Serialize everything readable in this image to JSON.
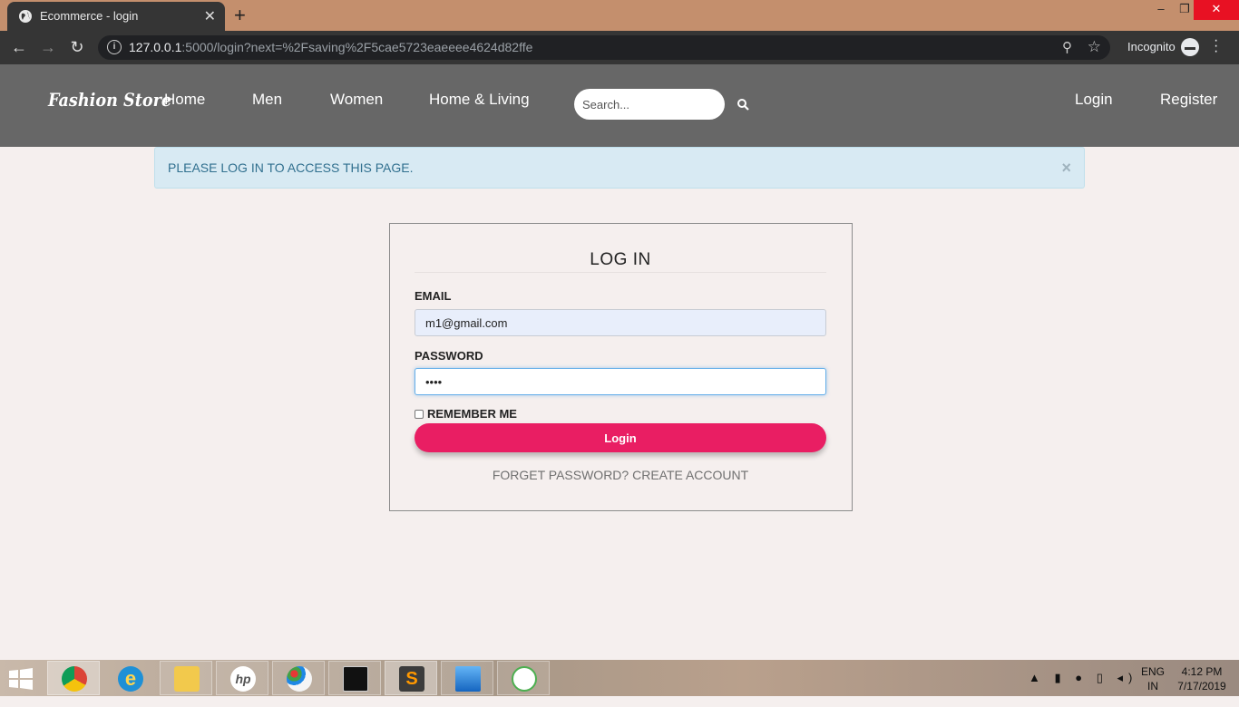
{
  "browser": {
    "tab_title": "Ecommerce - login",
    "tab_close": "✕",
    "new_tab": "+",
    "url_host": "127.0.0.1",
    "url_rest": ":5000/login?next=%2Fsaving%2F5cae5723eaeeee4624d82ffe",
    "incognito_label": "Incognito",
    "window_controls": {
      "minimize": "–",
      "maximize": "❐",
      "close": "✕"
    }
  },
  "navbar": {
    "brand": "Fashion Store",
    "links": [
      "Home",
      "Men",
      "Women",
      "Home & Living"
    ],
    "search_placeholder": "Search...",
    "login": "Login",
    "register": "Register"
  },
  "alert": {
    "message": "PLEASE LOG IN TO ACCESS THIS PAGE.",
    "close": "×"
  },
  "login_form": {
    "title": "LOG IN",
    "email_label": "EMAIL",
    "email_value": "m1@gmail.com",
    "password_label": "PASSWORD",
    "password_value": "••••",
    "remember_label": "REMEMBER ME",
    "remember_checked": false,
    "submit_label": "Login",
    "forgot_label": "FORGET PASSWORD?",
    "create_label": "CREATE ACCOUNT"
  },
  "taskbar": {
    "apps": [
      "chrome",
      "internet-explorer",
      "file-explorer",
      "hp",
      "paint",
      "command-prompt",
      "sublime-text",
      "photos",
      "mongodb"
    ],
    "lang_top": "ENG",
    "lang_bottom": "IN",
    "time": "4:12 PM",
    "date": "7/17/2019"
  },
  "colors": {
    "navbar_bg": "#676767",
    "accent_button": "#e91e63",
    "alert_bg": "#d8eaf3",
    "alert_text": "#31708f",
    "page_bg": "#f5efee"
  }
}
